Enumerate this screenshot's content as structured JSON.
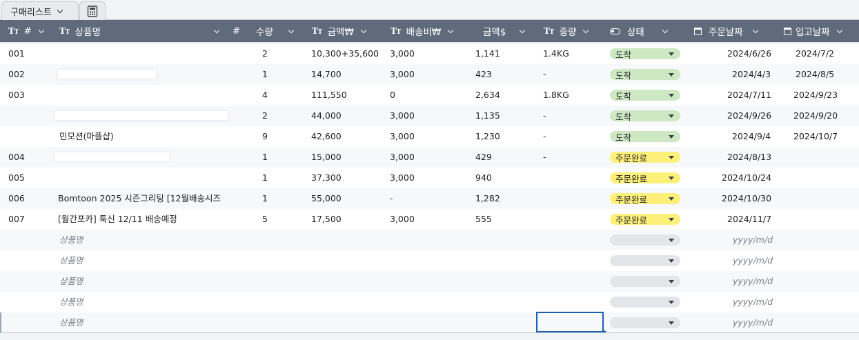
{
  "tabs": {
    "main_label": "구매리스트"
  },
  "header": {
    "num": "#",
    "name": "상품명",
    "hash": "#",
    "qty": "수량",
    "amount_krw": "금액₩",
    "shipping": "배송비₩",
    "amount_usd": "금액$",
    "weight": "중량",
    "status": "상태",
    "order_date": "주문날짜",
    "arrival_date": "입고날짜"
  },
  "rows": [
    {
      "num": "001",
      "name": "",
      "qty": "2",
      "amount_krw": "10,300+35,600",
      "shipping": "3,000",
      "amount_usd": "1,141",
      "weight": "1.4KG",
      "status": "도착",
      "order_date": "2024/6/26",
      "arrival_date": "2024/7/2"
    },
    {
      "num": "002",
      "name": "",
      "qty": "1",
      "amount_krw": "14,700",
      "shipping": "3,000",
      "amount_usd": "423",
      "weight": "-",
      "status": "도착",
      "order_date": "2024/4/3",
      "arrival_date": "2024/8/5"
    },
    {
      "num": "003",
      "name": "",
      "qty": "4",
      "amount_krw": "111,550",
      "shipping": "0",
      "amount_usd": "2,634",
      "weight": "1.8KG",
      "status": "도착",
      "order_date": "2024/7/11",
      "arrival_date": "2024/9/23"
    },
    {
      "num": "",
      "name": "",
      "qty": "2",
      "amount_krw": "44,000",
      "shipping": "3,000",
      "amount_usd": "1,135",
      "weight": "-",
      "status": "도착",
      "order_date": "2024/9/26",
      "arrival_date": "2024/9/20"
    },
    {
      "num": "",
      "name": "민모션(마플샵)",
      "qty": "9",
      "amount_krw": "42,600",
      "shipping": "3,000",
      "amount_usd": "1,230",
      "weight": "-",
      "status": "도착",
      "order_date": "2024/9/4",
      "arrival_date": "2024/10/7"
    },
    {
      "num": "004",
      "name": "",
      "qty": "1",
      "amount_krw": "15,000",
      "shipping": "3,000",
      "amount_usd": "429",
      "weight": "-",
      "status": "주문완료",
      "order_date": "2024/8/13",
      "arrival_date": ""
    },
    {
      "num": "005",
      "name": "",
      "qty": "1",
      "amount_krw": "37,300",
      "shipping": "3,000",
      "amount_usd": "940",
      "weight": "",
      "status": "주문완료",
      "order_date": "2024/10/24",
      "arrival_date": ""
    },
    {
      "num": "006",
      "name": "Bomtoon 2025 시즌그리팅 [12월배송시즈",
      "qty": "1",
      "amount_krw": "55,000",
      "shipping": "-",
      "amount_usd": "1,282",
      "weight": "",
      "status": "주문완료",
      "order_date": "2024/10/30",
      "arrival_date": ""
    },
    {
      "num": "007",
      "name": "[월간포카] 툭신 12/11 배송예정",
      "qty": "5",
      "amount_krw": "17,500",
      "shipping": "3,000",
      "amount_usd": "555",
      "weight": "",
      "status": "주문완료",
      "order_date": "2024/11/7",
      "arrival_date": ""
    }
  ],
  "empty_rows": [
    {
      "name_placeholder": "상품명",
      "date_placeholder": "yyyy/m/d"
    },
    {
      "name_placeholder": "상품명",
      "date_placeholder": "yyyy/m/d"
    },
    {
      "name_placeholder": "상품명",
      "date_placeholder": "yyyy/m/d"
    },
    {
      "name_placeholder": "상품명",
      "date_placeholder": "yyyy/m/d"
    },
    {
      "name_placeholder": "상품명",
      "date_placeholder": "yyyy/m/d"
    }
  ],
  "colors": {
    "header_bg": "#5f6a7a",
    "status_arrived": "#cfe8c4",
    "status_ordered": "#fdf07a",
    "status_empty": "#e3e5e8",
    "selection": "#1a5fb4"
  },
  "icons": {
    "tab_extra": "calculator-icon",
    "text_column": "text-type-icon",
    "status_column": "toggle-icon",
    "date_column": "calendar-icon"
  }
}
